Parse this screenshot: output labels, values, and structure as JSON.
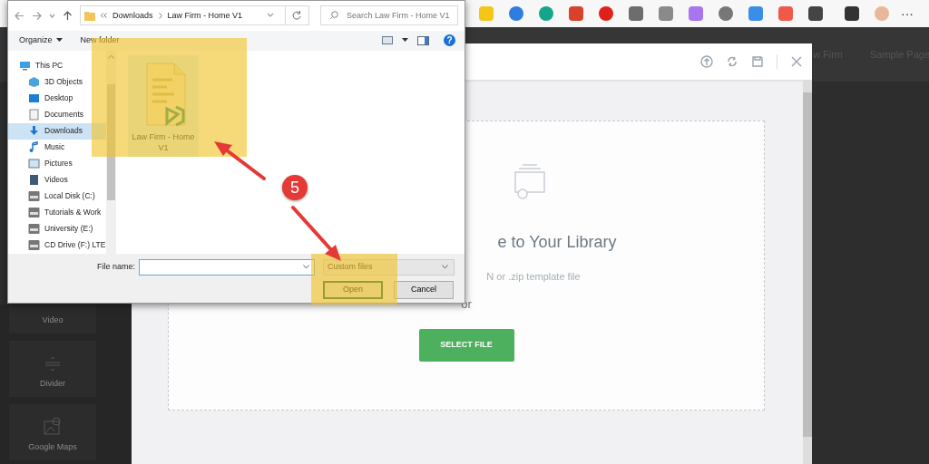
{
  "browser": {
    "extensions": [
      {
        "color": "#f5c518"
      },
      {
        "color": "#2f7de1"
      },
      {
        "color": "#15a58a"
      },
      {
        "color": "#d9412b"
      },
      {
        "color": "#e0201b"
      },
      {
        "color": "#6d6d6d"
      },
      {
        "color": "#8a8a8a"
      },
      {
        "color": "#a875f0"
      },
      {
        "color": "#777777"
      },
      {
        "color": "#3b8ee8"
      },
      {
        "color": "#f0584a"
      },
      {
        "color": "#444444"
      },
      {
        "color": "#333333"
      },
      {
        "color": "#e8b79a"
      }
    ],
    "more": "···"
  },
  "site_nav": [
    "w Firm",
    "Sample Page"
  ],
  "widgets": [
    {
      "label": "Video",
      "kind": "plain"
    },
    {
      "label": "Divider",
      "kind": "divider"
    },
    {
      "label": "Google Maps",
      "kind": "map"
    }
  ],
  "modal": {
    "heading": "e to Your Library",
    "hint": "N or .zip template file",
    "or": "or",
    "button": "SELECT FILE"
  },
  "file_dialog": {
    "path": [
      "Downloads",
      "Law Firm - Home V1"
    ],
    "search_placeholder": "Search Law Firm - Home V1",
    "toolbar": [
      "Organize",
      "New folder"
    ],
    "help": "?",
    "nav": [
      {
        "label": "This PC",
        "kind": "pc",
        "selected": false,
        "children": [
          {
            "label": "3D Objects",
            "kind": "cube",
            "selected": false
          },
          {
            "label": "Desktop",
            "kind": "desktop",
            "selected": false
          },
          {
            "label": "Documents",
            "kind": "document",
            "selected": false
          },
          {
            "label": "Downloads",
            "kind": "download",
            "selected": true
          },
          {
            "label": "Music",
            "kind": "music",
            "selected": false
          },
          {
            "label": "Pictures",
            "kind": "pictures",
            "selected": false
          },
          {
            "label": "Videos",
            "kind": "videos",
            "selected": false
          },
          {
            "label": "Local Disk (C:)",
            "kind": "disk",
            "selected": false
          },
          {
            "label": "Tutorials & Work",
            "kind": "disk",
            "selected": false
          },
          {
            "label": "University (E:)",
            "kind": "disk",
            "selected": false
          },
          {
            "label": "CD Drive (F:) LTE",
            "kind": "disk",
            "selected": false
          }
        ]
      }
    ],
    "files": [
      {
        "name": "Law Firm - Home V1",
        "selected": true
      }
    ],
    "file_name_label": "File name:",
    "file_type": "Custom files",
    "buttons": [
      {
        "label": "Open",
        "default": true
      },
      {
        "label": "Cancel",
        "default": false
      }
    ]
  },
  "annotation": {
    "step": "5"
  }
}
